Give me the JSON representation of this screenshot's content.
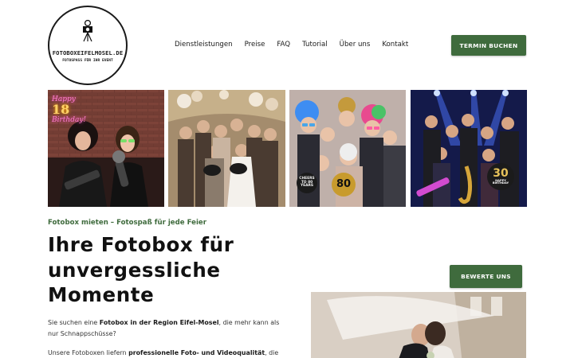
{
  "logo": {
    "brand": "FOTOBOXEIFELMOSEL.DE",
    "tagline": "FOTOSPASS FÜR IHR EVENT",
    "icon": "camera-tripod-icon"
  },
  "nav": {
    "items": [
      {
        "label": "Dienstleistungen"
      },
      {
        "label": "Preise"
      },
      {
        "label": "FAQ"
      },
      {
        "label": "Tutorial"
      },
      {
        "label": "Über uns"
      },
      {
        "label": "Kontakt"
      }
    ]
  },
  "header": {
    "cta_label": "TERMIN BUCHEN"
  },
  "gallery": {
    "photo1": {
      "sign_happy": "Happy",
      "sign_number": "18",
      "sign_birthday": "Birthday!"
    },
    "photo2": {
      "sign_a": "",
      "sign_b": ""
    },
    "photo3": {
      "sign_cheers": "CHEERS TO 80 YEARS",
      "sign_number": "80"
    },
    "photo4": {
      "sign_number": "30",
      "sign_happy": "HAPPY BIRTHDAY"
    }
  },
  "hero": {
    "kicker": "Fotobox mieten – Fotospaß für jede Feier",
    "headline": "Ihre Fotobox für unvergessliche Momente",
    "para1_pre": "Sie suchen eine ",
    "para1_bold": "Fotobox in der Region Eifel-Mosel",
    "para1_post": ", die mehr kann als nur Schnappschüsse?",
    "para2_pre": "Unsere Fotoboxen liefern ",
    "para2_bold": "professionelle Foto- und Videoqualität",
    "para2_post": ", die"
  },
  "review": {
    "button_label": "BEWERTE UNS"
  },
  "colors": {
    "accent": "#3f6b3d",
    "text": "#111111"
  }
}
